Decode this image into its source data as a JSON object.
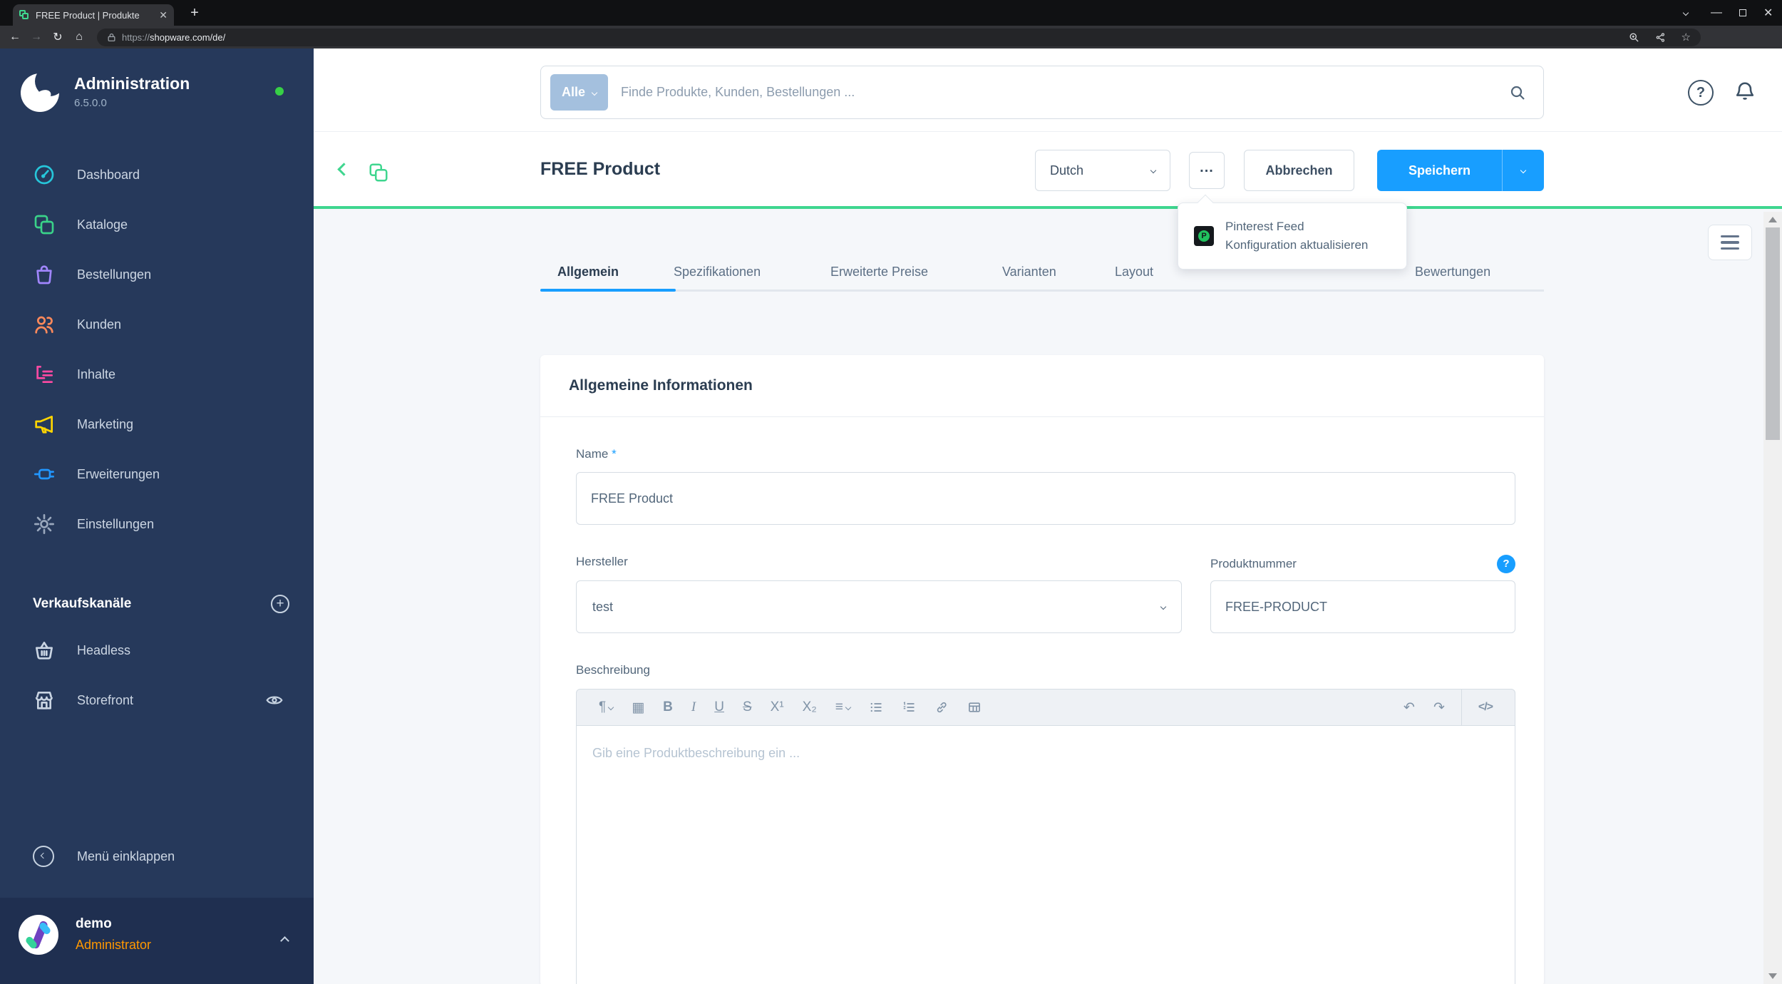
{
  "browser": {
    "tab_title": "FREE Product | Produkte",
    "url_scheme": "https://",
    "url_host": "shopware.com/de/"
  },
  "sidebar": {
    "app_title": "Administration",
    "version": "6.5.0.0",
    "items": [
      {
        "label": "Dashboard",
        "icon": "gauge-icon",
        "color": "#26c6da"
      },
      {
        "label": "Kataloge",
        "icon": "catalog-icon",
        "color": "#3ad289"
      },
      {
        "label": "Bestellungen",
        "icon": "shopping-bag-icon",
        "color": "#a186ff"
      },
      {
        "label": "Kunden",
        "icon": "customers-icon",
        "color": "#ff8a5b"
      },
      {
        "label": "Inhalte",
        "icon": "content-icon",
        "color": "#ff4aa3"
      },
      {
        "label": "Marketing",
        "icon": "megaphone-icon",
        "color": "#ffd500"
      },
      {
        "label": "Erweiterungen",
        "icon": "plug-icon",
        "color": "#2196ff"
      },
      {
        "label": "Einstellungen",
        "icon": "gear-icon",
        "color": "#9aa8bd"
      }
    ],
    "sales_channels": {
      "heading": "Verkaufskanäle",
      "items": [
        {
          "label": "Headless",
          "icon": "basket-icon"
        },
        {
          "label": "Storefront",
          "icon": "storefront-icon"
        }
      ]
    },
    "collapse_label": "Menü einklappen",
    "user": {
      "name": "demo",
      "role": "Administrator"
    }
  },
  "topbar": {
    "search_scope": "Alle",
    "search_placeholder": "Finde Produkte, Kunden, Bestellungen ..."
  },
  "smartbar": {
    "title": "FREE Product",
    "language_value": "Dutch",
    "more_label": "...",
    "cancel_label": "Abbrechen",
    "save_label": "Speichern"
  },
  "context_menu": {
    "items": [
      {
        "label": "Pinterest Feed Konfiguration aktualisieren",
        "icon": "pinterest-icon"
      }
    ]
  },
  "tabs": {
    "active": "Allgemein",
    "items": [
      "Allgemein",
      "Spezifikationen",
      "Erweiterte Preise",
      "Varianten",
      "Layout",
      "Bewertungen"
    ]
  },
  "card": {
    "title": "Allgemeine Informationen",
    "fields": {
      "name": {
        "label": "Name",
        "required_mark": "*",
        "value": "FREE Product"
      },
      "manufacturer": {
        "label": "Hersteller",
        "value": "test"
      },
      "product_number": {
        "label": "Produktnummer",
        "value": "FREE-PRODUCT"
      },
      "description": {
        "label": "Beschreibung",
        "placeholder": "Gib eine Produktbeschreibung ein ..."
      }
    },
    "editor_toolbar": [
      {
        "name": "paragraph-style",
        "glyph": "¶"
      },
      {
        "name": "color-swatch",
        "glyph": "▦"
      },
      {
        "name": "bold",
        "glyph": "B"
      },
      {
        "name": "italic",
        "glyph": "I"
      },
      {
        "name": "underline",
        "glyph": "U"
      },
      {
        "name": "strikethrough",
        "glyph": "S"
      },
      {
        "name": "superscript",
        "glyph": "X¹"
      },
      {
        "name": "subscript",
        "glyph": "X₂"
      },
      {
        "name": "text-align",
        "glyph": "≡"
      },
      {
        "name": "unordered-list",
        "glyph": ""
      },
      {
        "name": "ordered-list",
        "glyph": ""
      },
      {
        "name": "link",
        "glyph": ""
      },
      {
        "name": "table",
        "glyph": ""
      },
      {
        "name": "undo",
        "glyph": "↶"
      },
      {
        "name": "redo",
        "glyph": "↷"
      },
      {
        "name": "code",
        "glyph": "</>"
      }
    ]
  },
  "colors": {
    "accent_green": "#3fd68f",
    "brand_blue": "#189eff",
    "sidebar_bg": "#26395b",
    "user_role_orange": "#ff9800",
    "status_online_green": "#37d046"
  }
}
